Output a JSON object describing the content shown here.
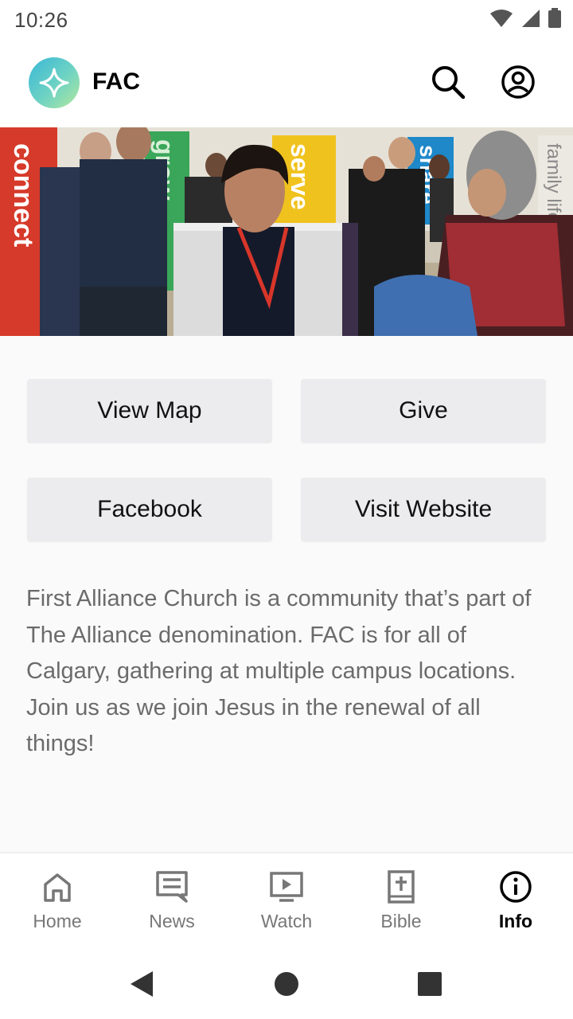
{
  "status_bar": {
    "time": "10:26",
    "icons": [
      "wifi-icon",
      "signal-icon",
      "battery-icon"
    ]
  },
  "header": {
    "title": "FAC",
    "logo_icon": "sparkle-star-icon",
    "actions": [
      "search-icon",
      "account-circle-icon"
    ]
  },
  "hero": {
    "description": "Photo of church members talking at a lobby event with banners",
    "banner_words": [
      "connect",
      "grow",
      "serve",
      "share",
      "family life"
    ]
  },
  "buttons": {
    "view_map": "View Map",
    "give": "Give",
    "facebook": "Facebook",
    "visit_website": "Visit Website"
  },
  "about_text": "First Alliance Church is a community that’s part of The Alliance denomination. FAC is for all of Calgary, gathering at multiple campus locations. Join us as we join Jesus in the renewal of all things!",
  "bottom_nav": {
    "items": [
      {
        "label": "Home",
        "icon": "home-icon",
        "active": false
      },
      {
        "label": "News",
        "icon": "news-icon",
        "active": false
      },
      {
        "label": "Watch",
        "icon": "watch-icon",
        "active": false
      },
      {
        "label": "Bible",
        "icon": "bible-icon",
        "active": false
      },
      {
        "label": "Info",
        "icon": "info-icon",
        "active": true
      }
    ]
  },
  "colors": {
    "button_bg": "#ececef",
    "text_muted": "#6b6b6b",
    "active_nav": "#000000",
    "inactive_nav": "#777777"
  }
}
